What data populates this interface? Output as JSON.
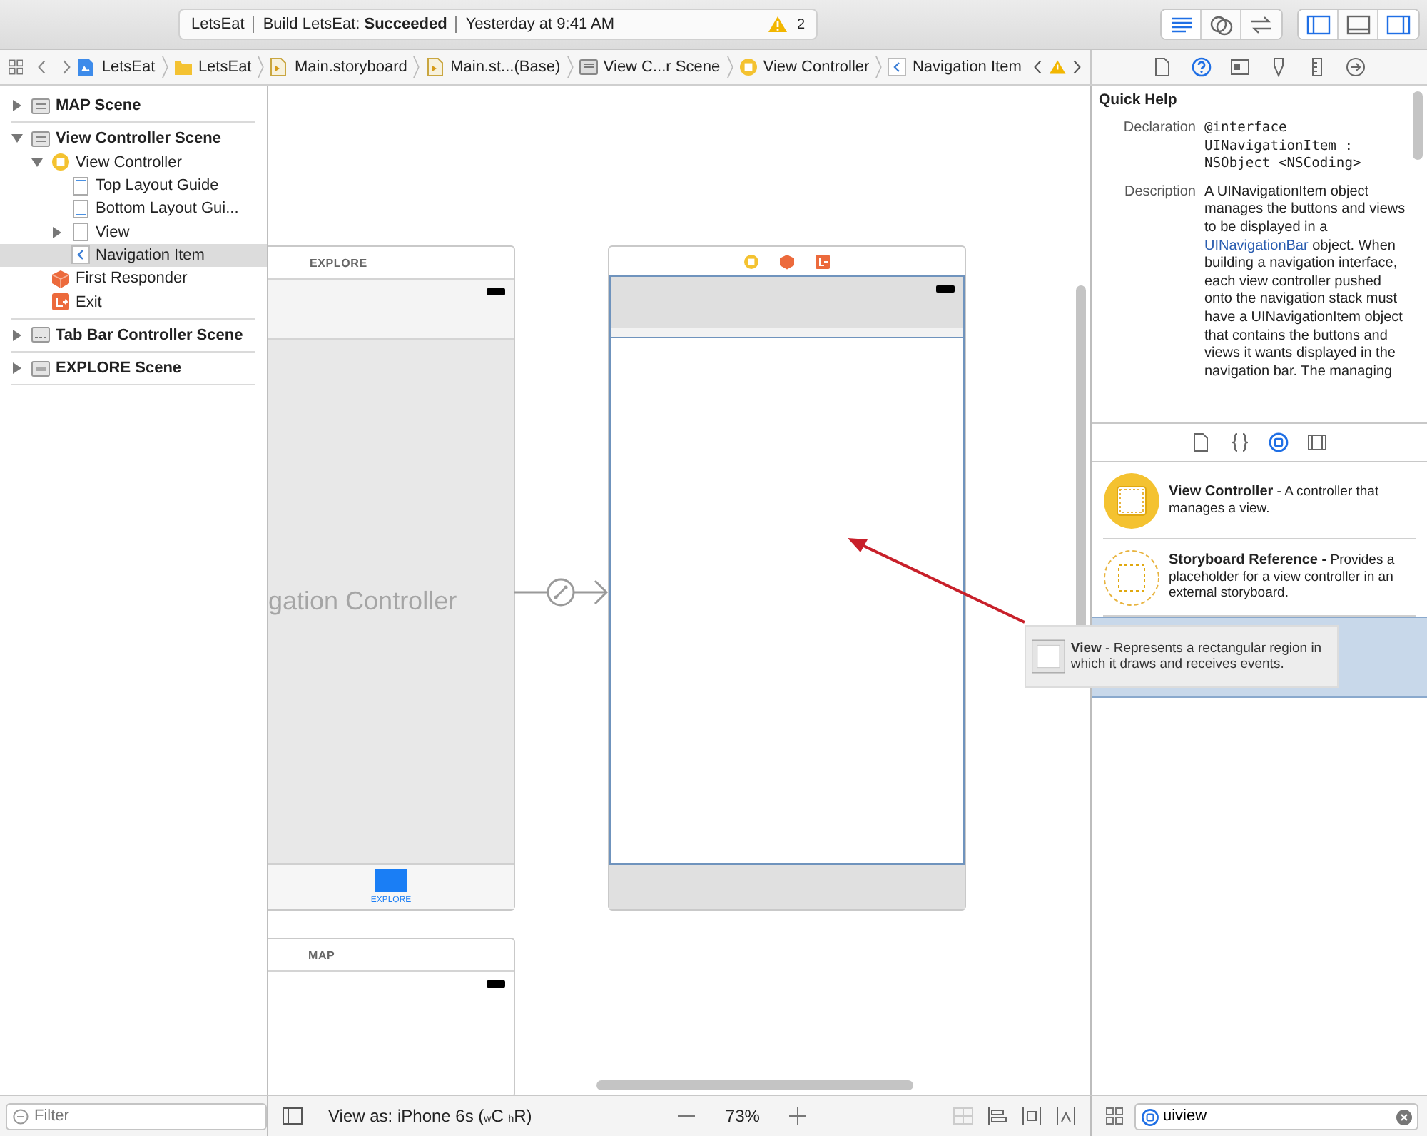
{
  "toolbar": {
    "scheme": "LetsEat",
    "build_status": "Build LetsEat: **Succeeded**",
    "time": "Yesterday at 9:41 AM",
    "warnings": "2",
    "editor_buttons": [
      {
        "kind": "standard",
        "selected": true
      },
      {
        "kind": "assistant",
        "selected": false
      },
      {
        "kind": "version",
        "selected": false
      }
    ],
    "panel_buttons": [
      {
        "kind": "navigator",
        "selected": true
      },
      {
        "kind": "debug",
        "selected": false
      },
      {
        "kind": "utilities",
        "selected": true
      }
    ]
  },
  "breadcrumbs": [
    {
      "kind": "project",
      "label": "LetsEat"
    },
    {
      "kind": "folder",
      "label": "LetsEat"
    },
    {
      "kind": "storyboard",
      "label": "Main.storyboard"
    },
    {
      "kind": "storyboard",
      "label": "Main.st...(Base)"
    },
    {
      "kind": "scene",
      "label": "View C...r Scene"
    },
    {
      "kind": "vc",
      "label": "View Controller"
    },
    {
      "kind": "nav",
      "label": "Navigation Item"
    }
  ],
  "inspector_tabs": [
    {
      "kind": "file",
      "selected": false
    },
    {
      "kind": "help",
      "selected": true
    },
    {
      "kind": "identity",
      "selected": false
    },
    {
      "kind": "attributes",
      "selected": false
    },
    {
      "kind": "size",
      "selected": false
    },
    {
      "kind": "connections",
      "selected": false
    }
  ],
  "outline": [
    {
      "kind": "scene",
      "label": "MAP Scene",
      "expanded": false,
      "selected": false
    },
    {
      "kind": "scene",
      "label": "View Controller Scene",
      "expanded": true,
      "selected": false,
      "children": [
        {
          "kind": "vc",
          "label": "View Controller",
          "expanded": true,
          "selected": false,
          "children": [
            {
              "kind": "top-guide",
              "label": "Top Layout Guide",
              "selected": false
            },
            {
              "kind": "bottom-guide",
              "label": "Bottom Layout Gui...",
              "selected": false
            },
            {
              "kind": "view",
              "label": "View",
              "expanded": false,
              "selected": false
            },
            {
              "kind": "nav",
              "label": "Navigation Item",
              "selected": true
            }
          ]
        },
        {
          "kind": "responder",
          "label": "First Responder",
          "selected": false
        },
        {
          "kind": "exit",
          "label": "Exit",
          "selected": false
        }
      ]
    },
    {
      "kind": "tabbar-scene",
      "label": "Tab Bar Controller Scene",
      "expanded": false,
      "selected": false
    },
    {
      "kind": "explore-scene",
      "label": "EXPLORE Scene",
      "expanded": false,
      "selected": false
    }
  ],
  "canvas": {
    "explore_scene": {
      "title": "EXPLORE",
      "controller_label": "gation Controller",
      "tab_label": "EXPLORE"
    },
    "map_scene": {
      "title": "MAP"
    }
  },
  "quick_help": {
    "title": "Quick Help",
    "declaration_label": "Declaration",
    "declaration": "@interface UINavigationItem : NSObject <NSCoding>",
    "description_label": "Description",
    "description": [
      {
        "kind": "text",
        "text": "A UINavigationItem object manages the buttons and views to be displayed in a"
      },
      {
        "kind": "link",
        "text": "UINavigationBar"
      },
      {
        "kind": "text",
        "text": "object. When building a navigation interface, each view controller pushed onto the navigation stack must have a UINavigationItem object that contains the buttons and views it wants displayed in the navigation bar. The managing"
      }
    ]
  },
  "library_tabs": [
    {
      "kind": "file",
      "selected": false
    },
    {
      "kind": "code",
      "selected": false
    },
    {
      "kind": "object",
      "selected": true
    },
    {
      "kind": "media",
      "selected": false
    }
  ],
  "library": [
    {
      "kind": "vc",
      "name": "View Controller",
      "description": "- A controller that manages a view.",
      "selected": false
    },
    {
      "kind": "reference",
      "name": "Storyboard Reference -",
      "description": "Provides a placeholder for a view controller in an external storyboard.",
      "selected": false
    },
    {
      "kind": "view",
      "selected": true
    }
  ],
  "drag_item": {
    "name": "View",
    "description": "- Represents a rectangular region in which it draws and receives events."
  },
  "bottom_bar": {
    "filter_placeholder": "Filter",
    "view_as": "View as: iPhone 6s ($_{w}$C $_{h}$R)",
    "zoom": "73%",
    "library_search": "uiview"
  }
}
